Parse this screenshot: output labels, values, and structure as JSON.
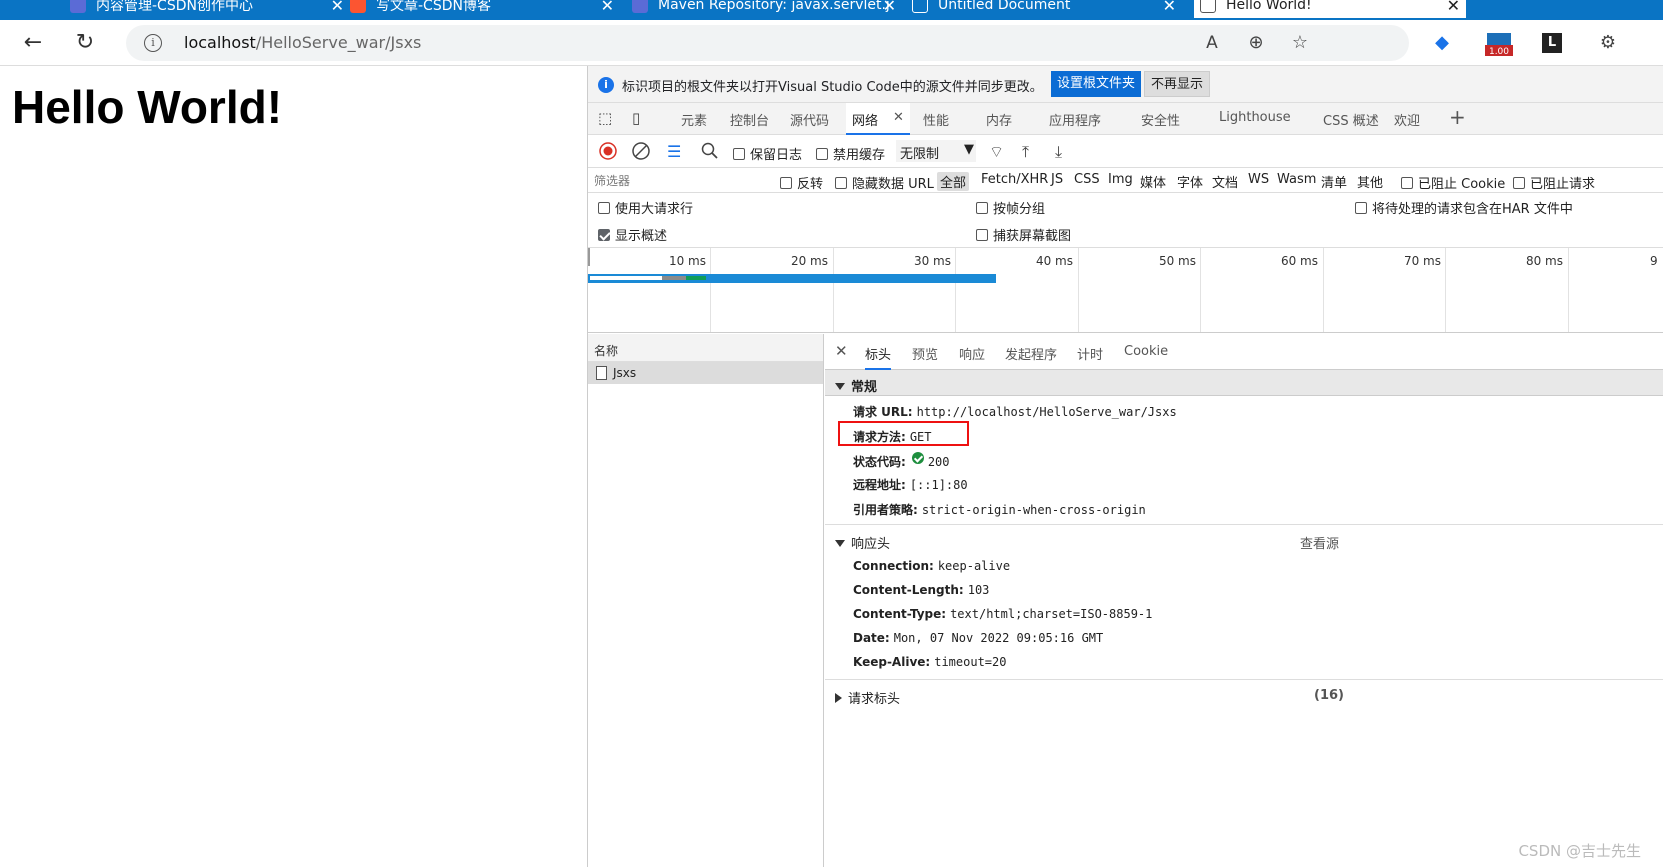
{
  "browser": {
    "tabs": [
      {
        "title": "内容管理-CSDN创作中心",
        "icon": "csdn-c-icon"
      },
      {
        "title": "写文章-CSDN博客",
        "icon": "csdn-c-icon"
      },
      {
        "title": "Maven Repository: javax.servlet.j",
        "icon": "maven-icon"
      },
      {
        "title": "Untitled Document",
        "icon": "page-icon"
      },
      {
        "title": "Hello World!",
        "icon": "page-icon"
      }
    ],
    "url_host": "localhost",
    "url_path": "/HelloServe_war/Jsxs",
    "extension_badge": "1.00"
  },
  "page": {
    "heading": "Hello World!"
  },
  "devtools": {
    "infobar_text": "标识项目的根文件夹以打开Visual Studio Code中的源文件并同步更改。",
    "infobar_primary": "设置根文件夹",
    "infobar_secondary": "不再显示",
    "tabs": [
      "元素",
      "控制台",
      "源代码",
      "网络",
      "性能",
      "内存",
      "应用程序",
      "安全性",
      "Lighthouse",
      "CSS 概述",
      "欢迎"
    ],
    "toolbar": {
      "preserve_log": "保留日志",
      "disable_cache": "禁用缓存",
      "throttle": "无限制"
    },
    "filter": {
      "placeholder": "筛选器",
      "invert": "反转",
      "hide_data_url": "隐藏数据 URL",
      "types": [
        "全部",
        "Fetch/XHR",
        "JS",
        "CSS",
        "Img",
        "媒体",
        "字体",
        "文档",
        "WS",
        "Wasm",
        "清单",
        "其他"
      ],
      "blocked_cookies": "已阻止 Cookie",
      "blocked_requests": "已阻止请求"
    },
    "options": {
      "big_rows": "使用大请求行",
      "group_by_frame": "按帧分组",
      "include_har": "将待处理的请求包含在HAR 文件中",
      "show_overview": "显示概述",
      "capture_screenshots": "捕获屏幕截图"
    },
    "timeline_ticks": [
      "10 ms",
      "20 ms",
      "30 ms",
      "40 ms",
      "50 ms",
      "60 ms",
      "70 ms",
      "80 ms",
      "9"
    ],
    "name_header": "名称",
    "requests": [
      "Jsxs"
    ],
    "detail_tabs": [
      "标头",
      "预览",
      "响应",
      "发起程序",
      "计时",
      "Cookie"
    ],
    "general": {
      "title": "常规",
      "rows": [
        {
          "key": "请求 URL:",
          "value": "http://localhost/HelloServe_war/Jsxs"
        },
        {
          "key": "请求方法:",
          "value": "GET"
        },
        {
          "key": "状态代码:",
          "value": "200"
        },
        {
          "key": "远程地址:",
          "value": "[::1]:80"
        },
        {
          "key": "引用者策略:",
          "value": "strict-origin-when-cross-origin"
        }
      ]
    },
    "response_headers": {
      "title": "响应头",
      "view_source": "查看源",
      "rows": [
        {
          "key": "Connection:",
          "value": "keep-alive"
        },
        {
          "key": "Content-Length:",
          "value": "103"
        },
        {
          "key": "Content-Type:",
          "value": "text/html;charset=ISO-8859-1"
        },
        {
          "key": "Date:",
          "value": "Mon, 07 Nov 2022 09:05:16 GMT"
        },
        {
          "key": "Keep-Alive:",
          "value": "timeout=20"
        }
      ]
    },
    "request_headers": {
      "title": "请求标头",
      "count": "(16)"
    }
  },
  "watermark": "CSDN @吉士先生",
  "colors": {
    "accent": "#1a73e8",
    "tabstrip": "#0a74c4",
    "highlight": "#e11111",
    "status_ok": "#1e8e3e"
  }
}
